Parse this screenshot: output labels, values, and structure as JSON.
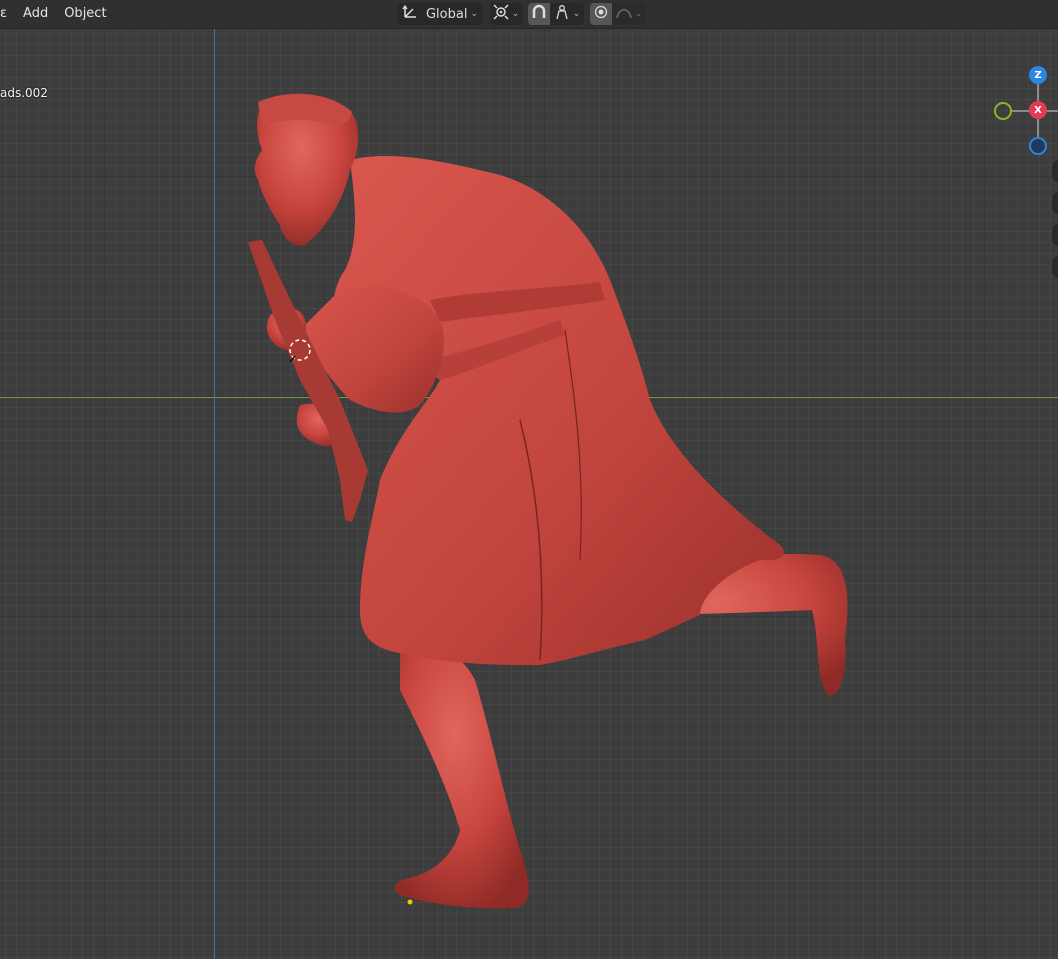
{
  "header": {
    "menu": [
      "ɛ",
      "Add",
      "Object"
    ],
    "orientation_label": "Global",
    "icons": {
      "transform_orientation": "transform-axes-icon",
      "pivot": "pivot-point-icon",
      "snap": "snap-magnet-icon",
      "snap_target": "snap-target-icon",
      "proportional_edit": "proportional-editing-icon",
      "falloff": "falloff-curve-icon"
    }
  },
  "viewport": {
    "object_name": "ads.002",
    "model_color": "#d4524a",
    "background_color": "#3d3d3d",
    "x_axis_color": "#8cb33a",
    "z_axis_color": "#3d6fc0"
  },
  "gizmo": {
    "z_label": "Z",
    "x_label": "X",
    "x_color": "#e53a55",
    "y_color": "#8bb523",
    "z_color": "#2b86e0"
  }
}
